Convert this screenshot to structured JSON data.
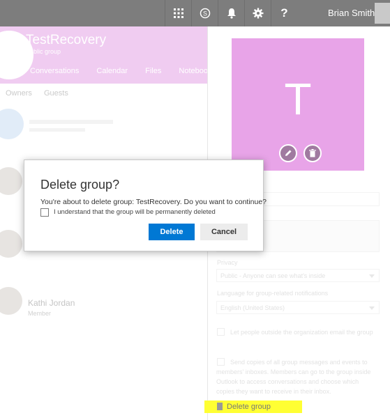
{
  "topbar": {
    "icons": [
      "app-launcher-icon",
      "skype-icon",
      "bell-icon",
      "gear-icon",
      "help-icon"
    ],
    "user_name": "Brian Smith"
  },
  "group": {
    "title": "TestRecovery",
    "subtitle": "Public group",
    "tabs": [
      "Conversations",
      "Calendar",
      "Files",
      "Notebook"
    ],
    "sub_tabs": [
      "Owners",
      "Guests"
    ],
    "member_name": "Kathi Jordan",
    "member_role": "Member"
  },
  "panel": {
    "tile_letter": "T",
    "privacy_label": "Privacy",
    "privacy_value": "Public - Anyone can see what's inside",
    "language_label": "Language for group-related notifications",
    "language_value": "English (United States)",
    "option_external_email": "Let people outside the organization email the group",
    "option_send_copies": "Send copies of all group messages and events to members' inboxes. Members can go to the group inside Outlook to access conversations and choose which copies they want to receive in their inbox.",
    "delete_group_label": "Delete group",
    "highlight_color": "#ffff33",
    "tile_color": "#e8a4e8"
  },
  "dialog": {
    "title": "Delete group?",
    "message": "You're about to delete group: TestRecovery. Do you want to continue?",
    "checkbox_label": "I understand that the group will be permanently deleted",
    "delete_button": "Delete",
    "cancel_button": "Cancel",
    "accent_color": "#0078d4"
  }
}
